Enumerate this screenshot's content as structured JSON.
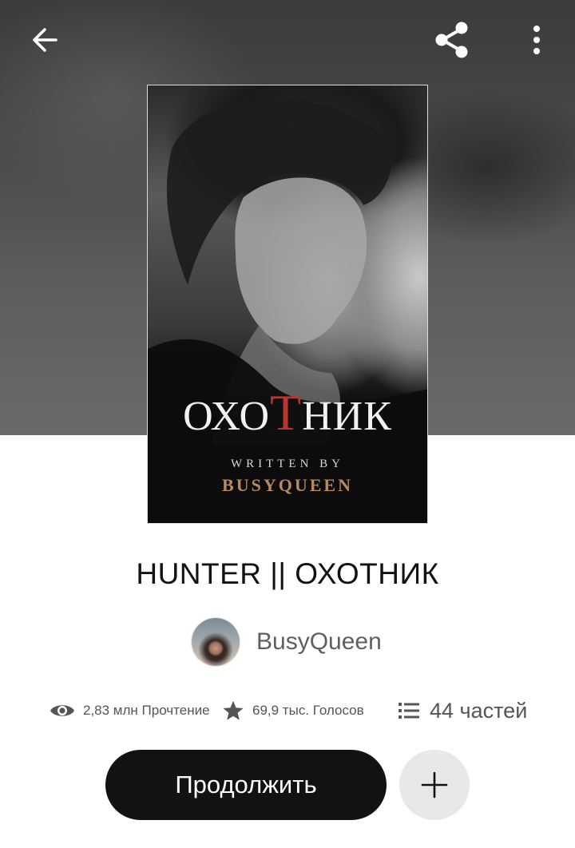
{
  "cover": {
    "title_part1": "ОХО",
    "title_red": "Т",
    "title_part2": "НИК",
    "written_by": "WRITTEN BY",
    "author": "BUSYQUEEN"
  },
  "story": {
    "title": "HUNTER || ОХОТНИК",
    "author_name": "BusyQueen"
  },
  "stats": {
    "reads": "2,83 млн Прочтение",
    "votes": "69,9 тыс. Голосов",
    "parts": "44 частей"
  },
  "actions": {
    "continue_label": "Продолжить"
  },
  "icons": {
    "back": "arrow-left-icon",
    "share": "share-icon",
    "more": "more-vertical-icon",
    "eye": "eye-icon",
    "star": "star-icon",
    "list": "list-icon",
    "plus": "plus-icon"
  },
  "colors": {
    "cover_title_accent": "#b8342d",
    "cover_author": "#b88a62",
    "button_dark": "#121212",
    "button_light": "#e8e8ea"
  }
}
